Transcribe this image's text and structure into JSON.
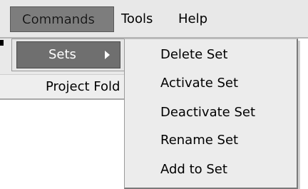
{
  "menubar": {
    "items": [
      {
        "label": "Commands",
        "active": true
      },
      {
        "label": "Tools"
      },
      {
        "label": "Help"
      }
    ]
  },
  "commands_menu": {
    "items": [
      {
        "label": "Sets",
        "has_submenu": true,
        "highlighted": true
      }
    ]
  },
  "sets_submenu": {
    "items": [
      {
        "label": "Delete Set"
      },
      {
        "label": "Activate Set"
      },
      {
        "label": "Deactivate Set"
      },
      {
        "label": "Rename Set"
      },
      {
        "label": "Add to Set"
      }
    ]
  },
  "background_window": {
    "row_label": "Project Fold"
  },
  "colors": {
    "menubar_bg": "#e8e8e8",
    "highlight_bg": "#6f6f6f",
    "menu_bg": "#ececec",
    "text": "#000000",
    "highlight_text": "#ffffff"
  }
}
